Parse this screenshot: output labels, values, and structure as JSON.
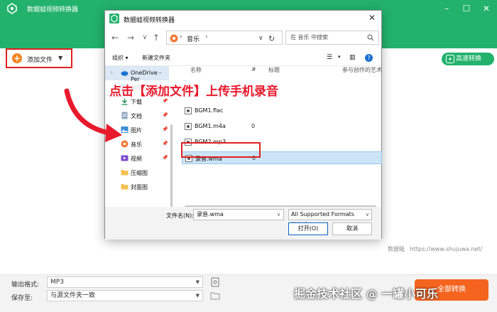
{
  "app": {
    "title": "数据蛙视频转换器",
    "add_file_label": "添加文件",
    "fast_convert_label": "高速转换",
    "watermark_brand": "数据蛙",
    "watermark_url": "https://www.shujuwa.net/",
    "bottom": {
      "output_format_label": "输出格式:",
      "output_format_value": "MP3",
      "save_to_label": "保存至:",
      "save_to_value": "与源文件夹一致",
      "convert_label": "全部转换"
    },
    "window_controls": [
      "minimize",
      "maximize",
      "close"
    ]
  },
  "dialog": {
    "title": "数据蛙视频转换器",
    "breadcrumb": [
      "音乐"
    ],
    "search_placeholder": "在 音乐 中搜索",
    "commands": {
      "organize": "组织",
      "new_folder": "新建文件夹"
    },
    "columns": [
      "名称",
      "#",
      "标题",
      "参与创作的艺术"
    ],
    "nav_items": [
      {
        "label": "OneDrive - Per",
        "icon": "cloud-icon",
        "pinned": false,
        "selected": true
      },
      {
        "label": "桌面",
        "icon": "desktop-icon",
        "pinned": true,
        "selected": false
      },
      {
        "label": "下载",
        "icon": "download-icon",
        "pinned": true,
        "selected": false
      },
      {
        "label": "文档",
        "icon": "document-icon",
        "pinned": true,
        "selected": false
      },
      {
        "label": "图片",
        "icon": "picture-icon",
        "pinned": true,
        "selected": false
      },
      {
        "label": "音乐",
        "icon": "music-icon",
        "pinned": true,
        "selected": false
      },
      {
        "label": "视频",
        "icon": "video-icon",
        "pinned": true,
        "selected": false
      },
      {
        "label": "压缩图",
        "icon": "folder-icon",
        "pinned": false,
        "selected": false
      },
      {
        "label": "封面图",
        "icon": "folder-icon",
        "pinned": false,
        "selected": false
      }
    ],
    "files": [
      {
        "name": "BGM1.flac",
        "num": "",
        "selected": false
      },
      {
        "name": "BGM1.m4a",
        "num": "0",
        "selected": false
      },
      {
        "name": "BGM2.mp3",
        "num": "",
        "selected": false
      },
      {
        "name": "录音.wma",
        "num": "0",
        "selected": true
      }
    ],
    "filename_label": "文件名(N):",
    "filename_value": "录音.wma",
    "filetype_value": "All Supported Formats (*.ts;*",
    "open_label": "打开(O)",
    "cancel_label": "取消"
  },
  "annotation": {
    "instruction": "点击【添加文件】上传手机录音",
    "site_watermark": "掘金技术社区 @ 一罐小可乐"
  },
  "colors": {
    "brand_green": "#22b26c",
    "accent_orange": "#f5641f",
    "annotation_red": "#e02020",
    "selection_blue": "#cce4f7"
  }
}
